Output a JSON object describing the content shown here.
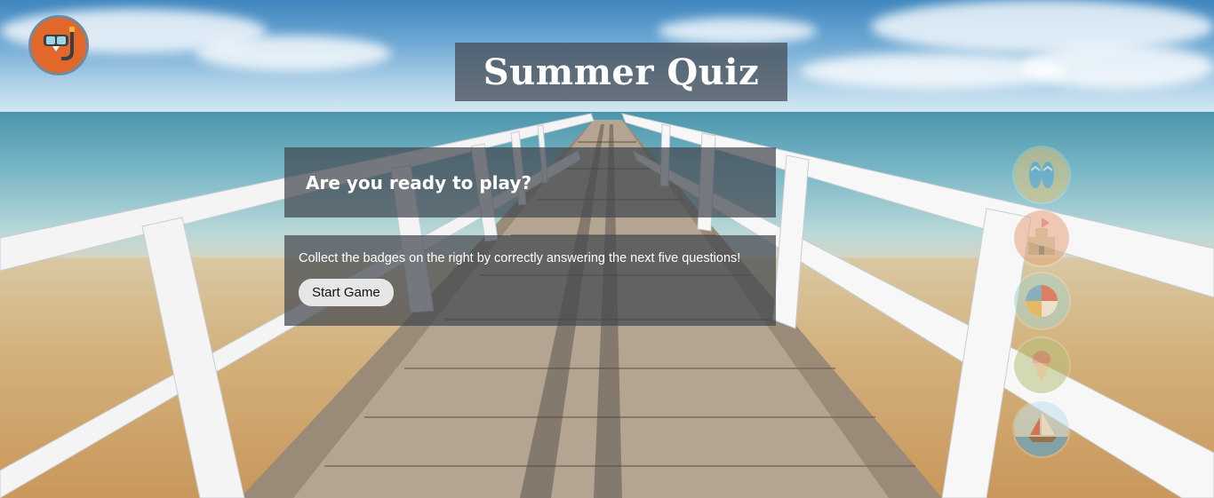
{
  "header": {
    "title": "Summer Quiz"
  },
  "logo": {
    "icon": "snorkel-mask-icon",
    "bg_color": "#e2672a"
  },
  "question": {
    "text": "Are you ready to play?"
  },
  "intro": {
    "text": "Collect the badges on the right by correctly answering the next five questions!",
    "start_button_label": "Start Game"
  },
  "badges": [
    {
      "icon": "flip-flops-icon",
      "bg_color": "#e0c37a"
    },
    {
      "icon": "sandcastle-icon",
      "bg_color": "#e8a37a"
    },
    {
      "icon": "beach-ball-icon",
      "bg_color": "#a8d3c6"
    },
    {
      "icon": "ice-cream-icon",
      "bg_color": "#b6c27a"
    },
    {
      "icon": "sailboat-icon",
      "bg_color": "#bfe3ee"
    }
  ],
  "colors": {
    "panel_bg": "rgba(66,72,80,0.72)",
    "button_bg": "#e6e6e6"
  }
}
